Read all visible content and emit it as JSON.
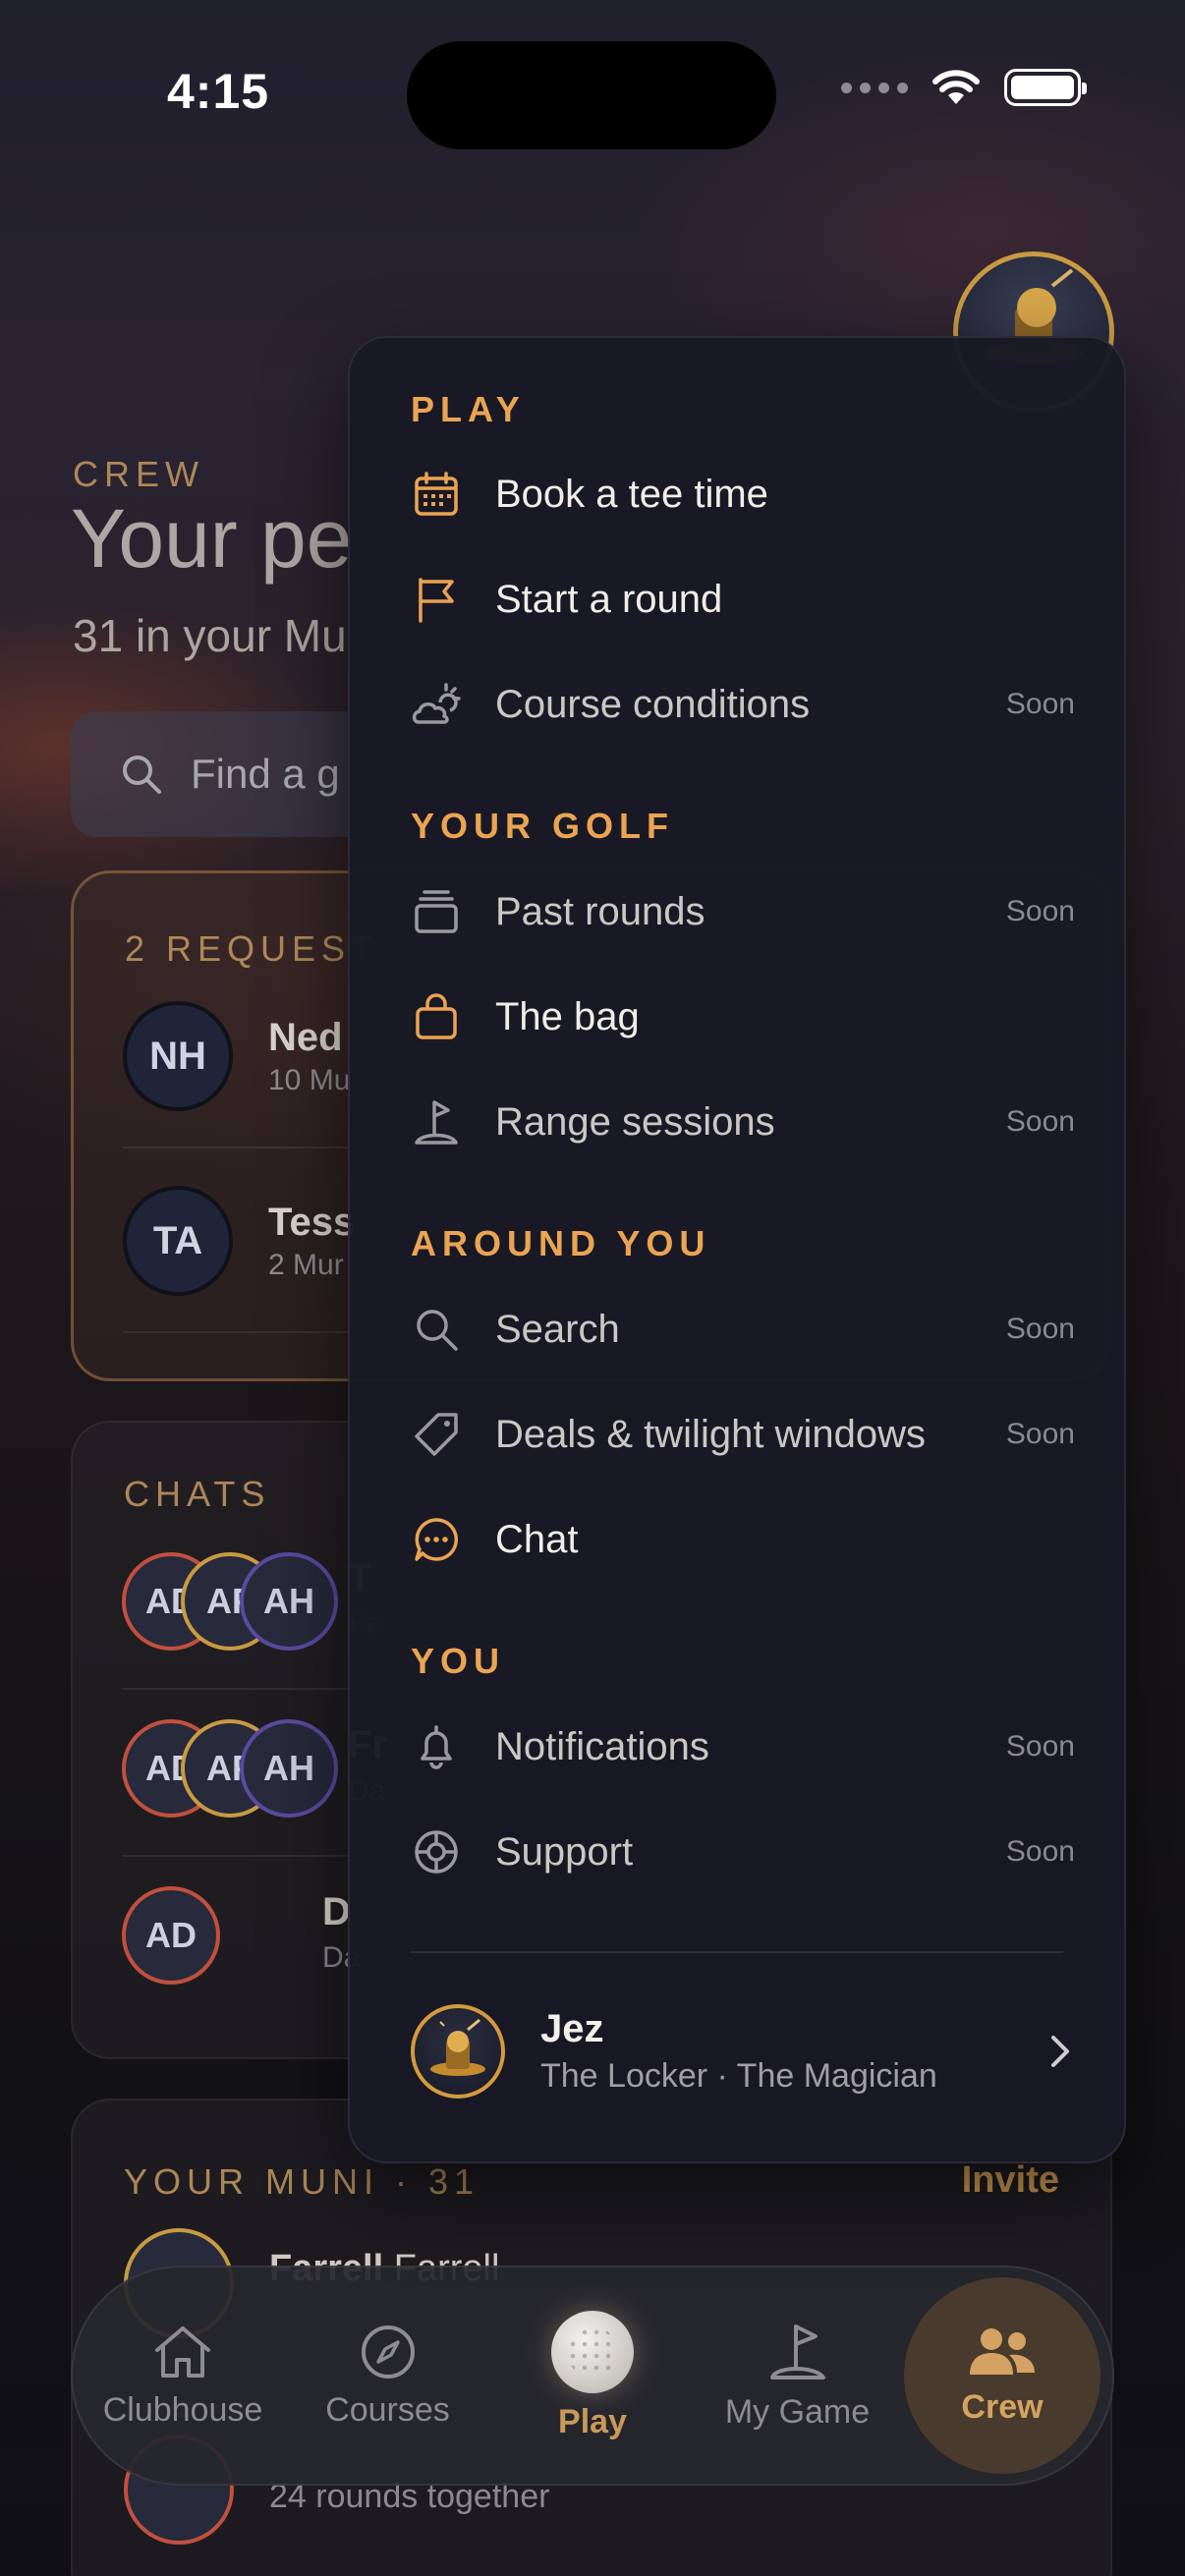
{
  "status_bar": {
    "time": "4:15"
  },
  "page": {
    "kicker": "CREW",
    "title": "Your pe",
    "subtitle": "31 in your Mu",
    "search_placeholder": "Find a g"
  },
  "requests": {
    "kicker": "2 REQUEST",
    "rows": [
      {
        "initials": "NH",
        "name": "Ned",
        "sub": "10 Mu"
      },
      {
        "initials": "TA",
        "name": "Tess",
        "sub": "2 Mur"
      }
    ]
  },
  "chats": {
    "kicker": "CHATS",
    "rows": [
      {
        "avatars": [
          "AD",
          "AF",
          "AH"
        ],
        "name": "T",
        "sub": "Fa"
      },
      {
        "avatars": [
          "AD",
          "AF",
          "AH"
        ],
        "name": "Fr",
        "sub": "Da"
      },
      {
        "avatars": [
          "AD"
        ],
        "name": "D",
        "sub": "Da"
      }
    ]
  },
  "muni": {
    "kicker": "YOUR MUNI · 31",
    "invite": "Invite",
    "row_name_bold": "Farrell",
    "row_name_rest": " Farrell",
    "bottom_sub": "24 rounds together"
  },
  "tabs": [
    {
      "label": "Clubhouse",
      "icon": "house-icon"
    },
    {
      "label": "Courses",
      "icon": "compass-icon"
    },
    {
      "label": "Play",
      "icon": "golf-ball-icon"
    },
    {
      "label": "My Game",
      "icon": "golf-flag-icon"
    },
    {
      "label": "Crew",
      "icon": "people-icon"
    }
  ],
  "menu": {
    "sections": [
      {
        "title": "PLAY",
        "items": [
          {
            "label": "Book a tee time",
            "icon": "calendar-icon",
            "badge": ""
          },
          {
            "label": "Start a round",
            "icon": "flag-icon",
            "badge": ""
          },
          {
            "label": "Course conditions",
            "icon": "weather-icon",
            "badge": "Soon"
          }
        ]
      },
      {
        "title": "YOUR GOLF",
        "items": [
          {
            "label": "Past rounds",
            "icon": "stack-icon",
            "badge": "Soon"
          },
          {
            "label": "The bag",
            "icon": "bag-icon",
            "badge": ""
          },
          {
            "label": "Range sessions",
            "icon": "range-flag-icon",
            "badge": "Soon"
          }
        ]
      },
      {
        "title": "AROUND YOU",
        "items": [
          {
            "label": "Search",
            "icon": "search-icon",
            "badge": "Soon"
          },
          {
            "label": "Deals & twilight windows",
            "icon": "tag-icon",
            "badge": "Soon"
          },
          {
            "label": "Chat",
            "icon": "chat-bubble-icon",
            "badge": ""
          }
        ]
      },
      {
        "title": "YOU",
        "items": [
          {
            "label": "Notifications",
            "icon": "bell-icon",
            "badge": "Soon"
          },
          {
            "label": "Support",
            "icon": "lifebuoy-icon",
            "badge": "Soon"
          }
        ]
      }
    ],
    "profile": {
      "name": "Jez",
      "subtitle": "The Locker · The Magician"
    }
  },
  "colors": {
    "accent": "#eaa452",
    "menu_bg": "#181924",
    "muted_text": "#8a8890"
  }
}
